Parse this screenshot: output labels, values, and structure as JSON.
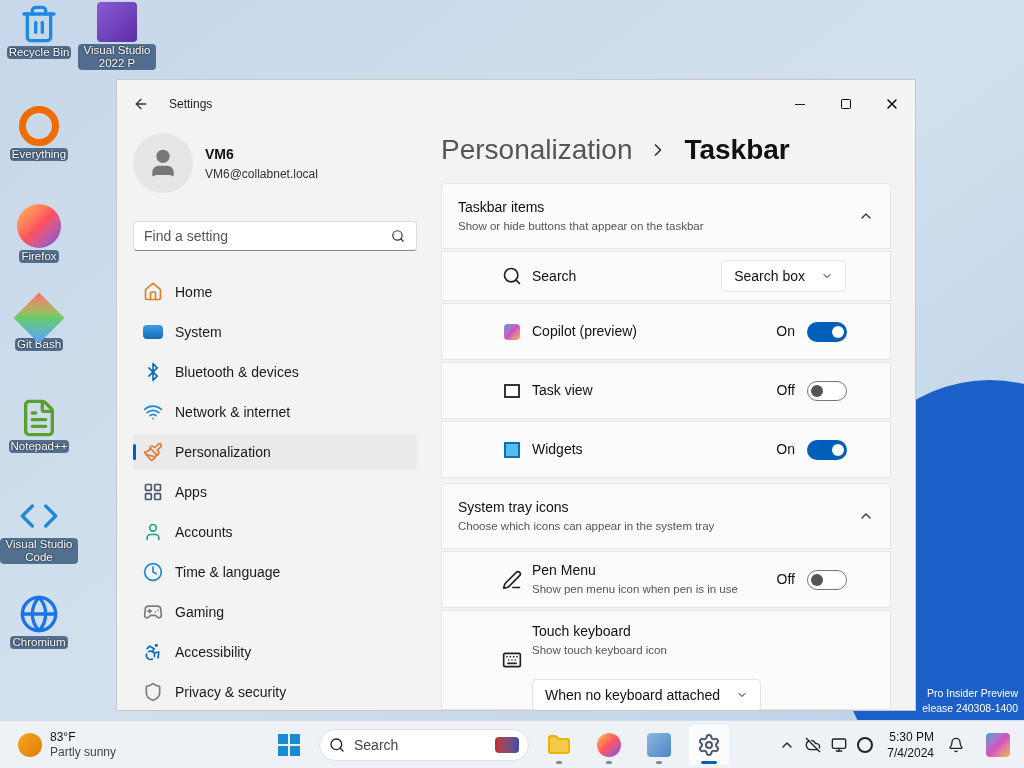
{
  "desktop": {
    "icons": [
      {
        "label": "Recycle Bin"
      },
      {
        "label": "Visual Studio 2022 P"
      },
      {
        "label": "Everything"
      },
      {
        "label": "Firefox"
      },
      {
        "label": "Git Bash"
      },
      {
        "label": "Notepad++"
      },
      {
        "label": "Visual Studio Code"
      },
      {
        "label": "Chromium"
      }
    ],
    "watermark_lines": [
      "Pro Insider Preview",
      "elease 240308-1400"
    ]
  },
  "window": {
    "title": "Settings"
  },
  "account": {
    "name": "VM6",
    "email": "VM6@collabnet.local"
  },
  "search": {
    "placeholder": "Find a setting"
  },
  "nav": [
    {
      "label": "Home",
      "selected": false
    },
    {
      "label": "System",
      "selected": false
    },
    {
      "label": "Bluetooth & devices",
      "selected": false
    },
    {
      "label": "Network & internet",
      "selected": false
    },
    {
      "label": "Personalization",
      "selected": true
    },
    {
      "label": "Apps",
      "selected": false
    },
    {
      "label": "Accounts",
      "selected": false
    },
    {
      "label": "Time & language",
      "selected": false
    },
    {
      "label": "Gaming",
      "selected": false
    },
    {
      "label": "Accessibility",
      "selected": false
    },
    {
      "label": "Privacy & security",
      "selected": false
    }
  ],
  "breadcrumb": [
    "Personalization",
    "Taskbar"
  ],
  "sections": [
    {
      "title": "Taskbar items",
      "subtitle": "Show or hide buttons that appear on the taskbar",
      "expanded": true,
      "rows": [
        {
          "kind": "dropdown",
          "label": "Search",
          "value": "Search box"
        },
        {
          "kind": "toggle",
          "label": "Copilot (preview)",
          "on": true,
          "state_text": "On"
        },
        {
          "kind": "toggle",
          "label": "Task view",
          "on": false,
          "state_text": "Off"
        },
        {
          "kind": "toggle",
          "label": "Widgets",
          "on": true,
          "state_text": "On"
        }
      ]
    },
    {
      "title": "System tray icons",
      "subtitle": "Choose which icons can appear in the system tray",
      "expanded": true,
      "rows": [
        {
          "kind": "toggle",
          "label": "Pen Menu",
          "subtitle": "Show pen menu icon when pen is in use",
          "on": false,
          "state_text": "Off"
        },
        {
          "kind": "dropdown-below",
          "label": "Touch keyboard",
          "subtitle": "Show touch keyboard icon",
          "value": "When no keyboard attached"
        }
      ]
    }
  ],
  "taskbar": {
    "weather": {
      "temp": "83°F",
      "condition": "Partly sunny"
    },
    "search_placeholder": "Search",
    "apps": [
      {
        "running": true,
        "selected": false
      },
      {
        "running": true,
        "selected": false
      },
      {
        "running": true,
        "selected": false
      },
      {
        "running": true,
        "selected": true
      }
    ],
    "time": "5:30 PM",
    "date": "7/4/2024"
  }
}
